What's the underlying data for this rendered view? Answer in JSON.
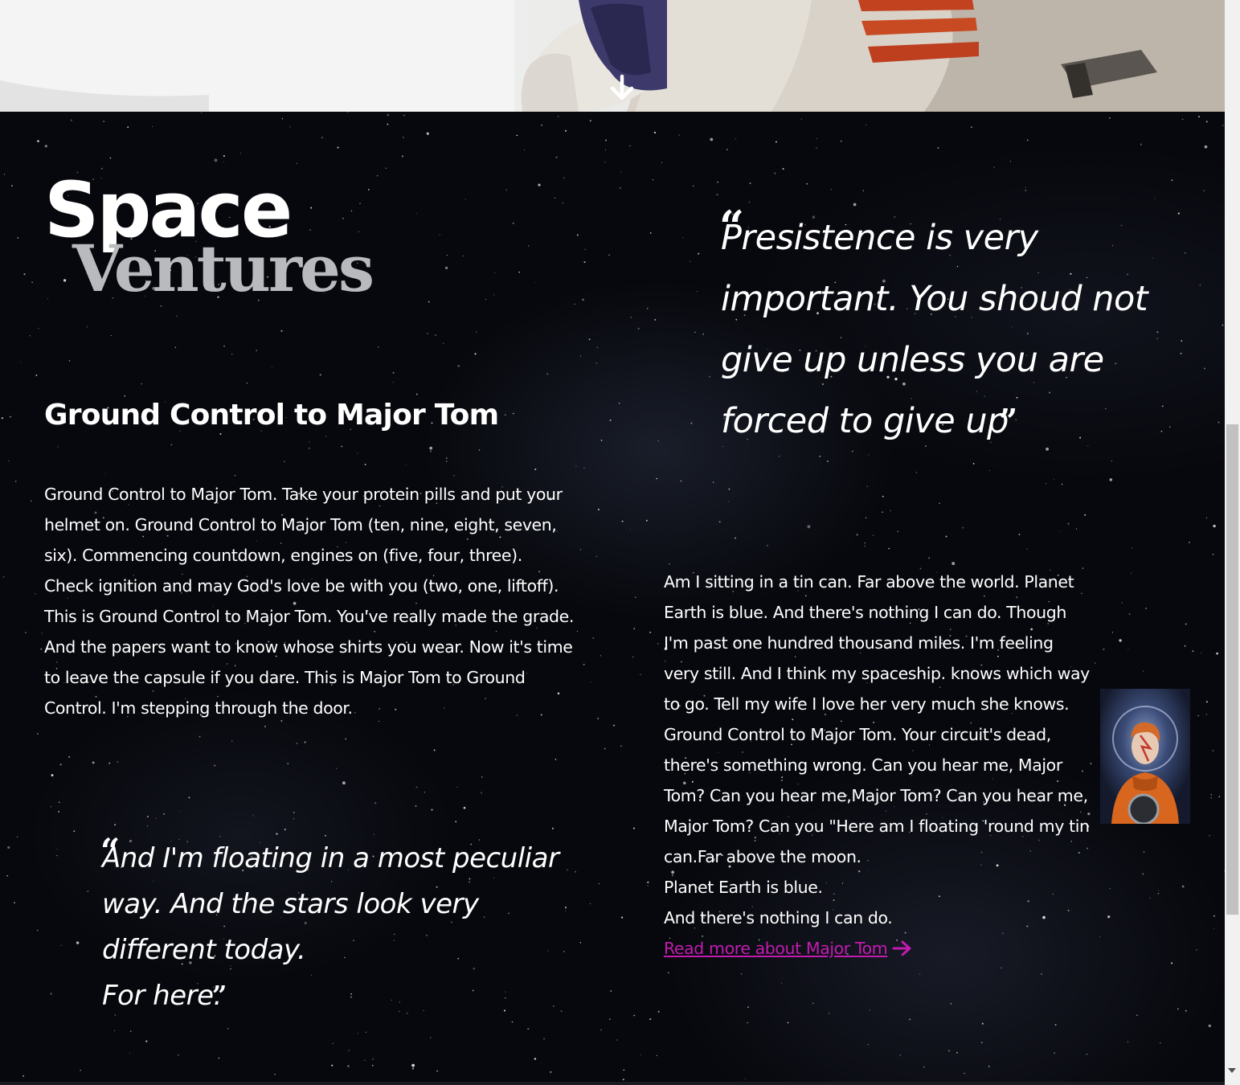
{
  "hero": {
    "scroll_icon": "arrow-down-icon"
  },
  "logo": {
    "line1": "Space",
    "line2": "Ventures"
  },
  "section": {
    "title": "Ground Control to Major Tom",
    "body_left": "Ground Control to Major Tom. Take your protein pills and put your helmet on. Ground Control to Major Tom (ten, nine, eight, seven, six). Commencing countdown, engines on (five, four, three). Check ignition and may God's love be with you (two, one, liftoff). This is Ground Control to Major Tom. You've really made the grade. And the papers want to know whose shirts you wear. Now it's time to leave the capsule if you dare. This is Major Tom to Ground Control. I'm stepping through the door."
  },
  "quotes": {
    "top": [
      "Presistence is very",
      "important. You shoud not",
      "give up unless you are",
      "forced to give up"
    ],
    "bottom": [
      "And I'm floating in a most peculiar",
      "way. And the stars look very",
      "different today.",
      "For here."
    ],
    "open_mark": "“",
    "close_mark": "”"
  },
  "right_column": {
    "paragraph1": "Am I sitting in a tin can. Far above the world. Planet Earth is blue. And there's nothing I can do. Though I'm past one hundred thousand miles. I'm feeling very still. And I think my spaceship. knows which way to go. Tell my wife I love her very much she knows.",
    "paragraph2": "Ground Control to Major Tom. Your circuit's dead, there's something wrong. Can you hear me, Major Tom? Can you hear me,Major Tom? Can you hear me, Major Tom? Can you \"Here am I floating 'round my tin can.Far above the moon.",
    "line3": "Planet Earth is blue.",
    "line4": "And there's nothing I can do.",
    "link_label": "Read more about Major Tom",
    "link_icon": "arrow-right-icon",
    "link_color": "#c21bb0"
  },
  "colors": {
    "background": "#07080d",
    "logo_secondary": "#b9babd",
    "accent": "#c21bb0"
  }
}
